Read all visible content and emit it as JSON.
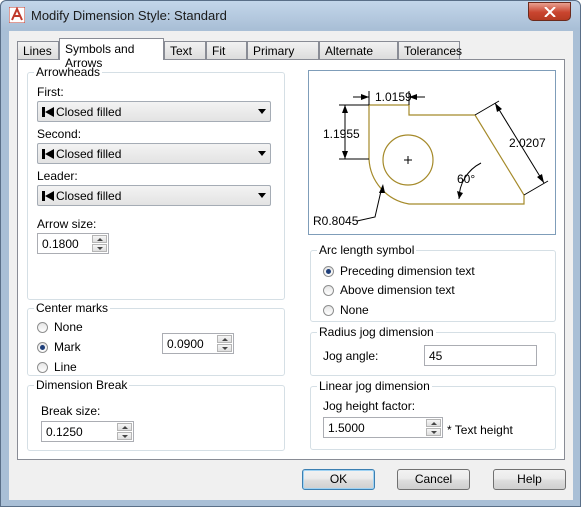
{
  "window": {
    "title": "Modify Dimension Style: Standard"
  },
  "tabs": [
    {
      "label": "Lines"
    },
    {
      "label": "Symbols and Arrows"
    },
    {
      "label": "Text"
    },
    {
      "label": "Fit"
    },
    {
      "label": "Primary Units"
    },
    {
      "label": "Alternate Units"
    },
    {
      "label": "Tolerances"
    }
  ],
  "arrowheads": {
    "title": "Arrowheads",
    "first_label": "First:",
    "first_value": "Closed filled",
    "second_label": "Second:",
    "second_value": "Closed filled",
    "leader_label": "Leader:",
    "leader_value": "Closed filled",
    "arrow_size_label": "Arrow size:",
    "arrow_size_value": "0.1800"
  },
  "center_marks": {
    "title": "Center marks",
    "options": [
      "None",
      "Mark",
      "Line"
    ],
    "selected": "Mark",
    "size_value": "0.0900"
  },
  "dimension_break": {
    "title": "Dimension Break",
    "break_size_label": "Break size:",
    "break_size_value": "0.1250"
  },
  "preview": {
    "dim_top": "1.0159",
    "dim_left": "1.1955",
    "dim_right": "2.0207",
    "angle": "60°",
    "radius": "R0.8045"
  },
  "arc_length": {
    "title": "Arc length symbol",
    "options": [
      "Preceding dimension text",
      "Above dimension text",
      "None"
    ],
    "selected": "Preceding dimension text"
  },
  "radius_jog": {
    "title": "Radius jog dimension",
    "jog_angle_label": "Jog angle:",
    "jog_angle_value": "45"
  },
  "linear_jog": {
    "title": "Linear jog dimension",
    "height_factor_label": "Jog height factor:",
    "height_factor_value": "1.5000",
    "suffix": "* Text height"
  },
  "buttons": {
    "ok": "OK",
    "cancel": "Cancel",
    "help": "Help"
  },
  "colors": {
    "preview_outline": "#a58a2a",
    "accent": "#3c7fb1"
  }
}
